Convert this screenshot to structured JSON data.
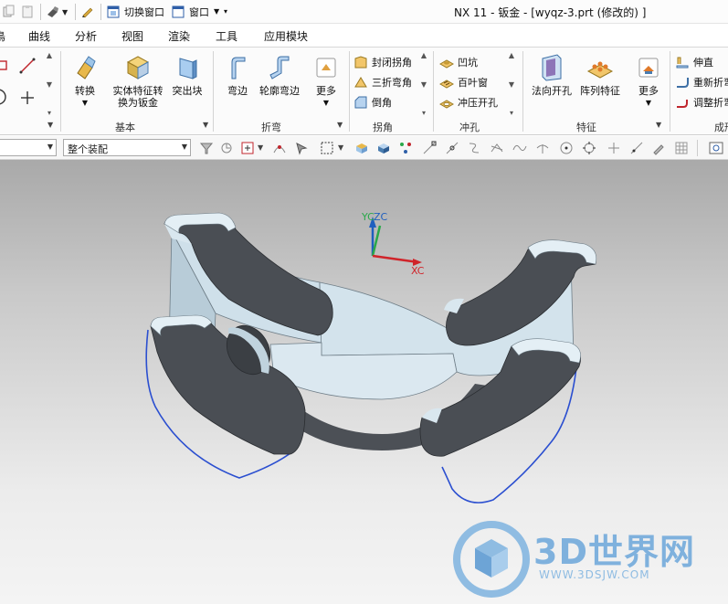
{
  "title_bar": {
    "switch_window_label": "切换窗口",
    "window_label": "窗口",
    "window_title": "NX 11 - 钣金 - [wyqz-3.prt  (修改的) ]"
  },
  "menu": {
    "items": [
      "曲线",
      "分析",
      "视图",
      "渲染",
      "工具",
      "应用模块"
    ]
  },
  "ribbon": {
    "groups": {
      "basic": "基本",
      "bend": "折弯",
      "corner": "拐角",
      "punch": "冲孔",
      "feature": "特征",
      "form": "成形"
    },
    "buttons": {
      "convert": "转换",
      "solid_to_sheet_1": "实体特征转",
      "solid_to_sheet_2": "换为钣金",
      "tab": "突出块",
      "flange": "弯边",
      "contour_flange": "轮廓弯边",
      "more1": "更多",
      "closed_corner": "封闭拐角",
      "three_bend_corner": "三折弯角",
      "chamfer": "倒角",
      "dimple": "凹坑",
      "louver": "百叶窗",
      "drawn_cutout": "冲压开孔",
      "normal_cutout": "法向开孔",
      "pattern_feature": "阵列特征",
      "more2": "更多",
      "unbend": "伸直",
      "rebend": "重新折弯",
      "adjust_bend": "调整折弯"
    }
  },
  "toolbar": {
    "selection_filter": "整个装配"
  },
  "viewport": {
    "axes": {
      "yc": "YC",
      "zc": "ZC",
      "xc": "XC"
    },
    "watermark": {
      "title": "3D世界网",
      "url": "WWW.3DSJW.COM"
    }
  }
}
